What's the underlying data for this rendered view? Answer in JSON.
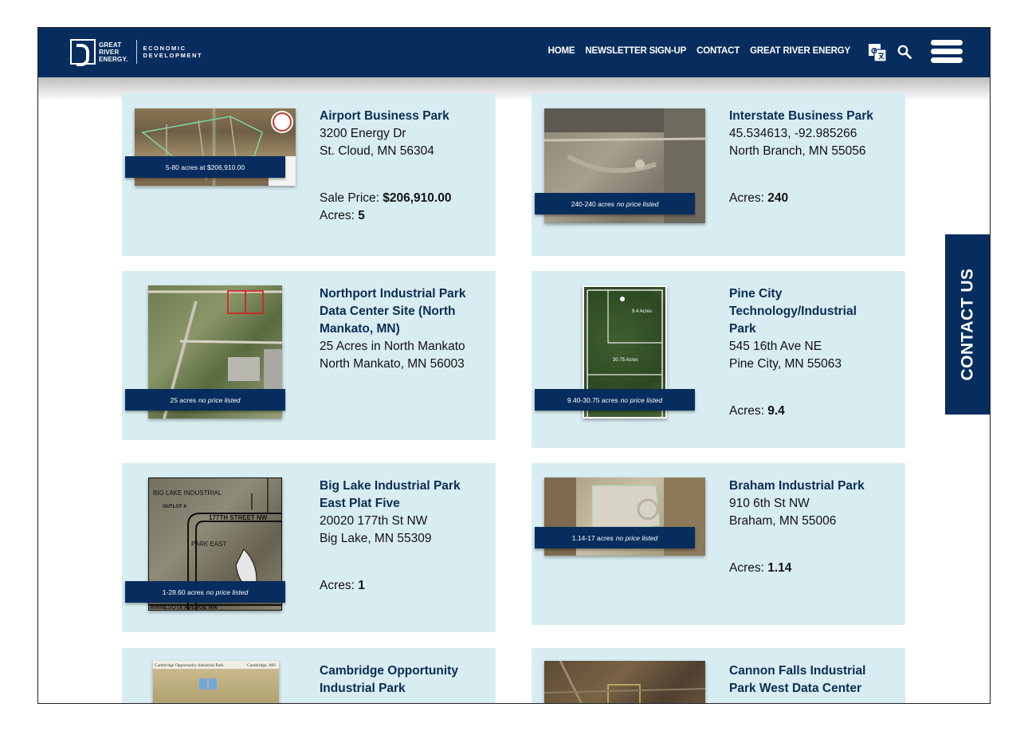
{
  "header": {
    "logo_line1": "GREAT",
    "logo_line2": "RIVER",
    "logo_line3": "ENERGY.",
    "logo_sub1": "ECONOMIC",
    "logo_sub2": "DEVELOPMENT",
    "nav": [
      "HOME",
      "NEWSLETTER SIGN-UP",
      "CONTACT",
      "GREAT RIVER ENERGY"
    ]
  },
  "contact_tab": "CONTACT US",
  "listings": [
    {
      "title": "Airport Business Park",
      "address1": "3200 Energy Dr",
      "address2": "St. Cloud, MN 56304",
      "sale_label": "Sale Price: ",
      "sale_value": "$206,910.00",
      "acres_label": "Acres: ",
      "acres_value": "5",
      "badge_text": "5-80 acres at $206,910.00",
      "badge_note": ""
    },
    {
      "title": "Interstate Business Park",
      "address1": "45.534613, -92.985266",
      "address2": "North Branch, MN 55056",
      "acres_label": "Acres: ",
      "acres_value": "240",
      "badge_text": "240-240 acres",
      "badge_note": "no price listed"
    },
    {
      "title_line1": "Northport Industrial Park",
      "title_line2": "Data Center Site (North",
      "title_line3": "Mankato, MN)",
      "address1": "25 Acres in North Mankato",
      "address2": "North Mankato, MN 56003",
      "badge_text": "25 acres",
      "badge_note": "no price listed"
    },
    {
      "title_line1": "Pine City",
      "title_line2": "Technology/Industrial",
      "title_line3": "Park",
      "address1": "545 16th Ave NE",
      "address2": "Pine City, MN 55063",
      "acres_label": "Acres: ",
      "acres_value": "9.4",
      "badge_text": "9.40-30.75 acres",
      "badge_note": "no price listed",
      "map_label1": "9.4 Acres",
      "map_label2": "30.75 Acres"
    },
    {
      "title_line1": "Big Lake Industrial Park",
      "title_line2": "East Plat Five",
      "address1": "20020 177th St NW",
      "address2": "Big Lake, MN 55309",
      "acres_label": "Acres: ",
      "acres_value": "1",
      "badge_text": "1-28.60 acres",
      "badge_note": "no price listed",
      "plat_label1": "BIG LAKE INDUSTRIAL",
      "plat_label2": "OUTLOT A",
      "plat_label3": "177TH STREET NW",
      "plat_label4": "PARK EAST",
      "plat_label5": "MINNESOTA AVENUE NW"
    },
    {
      "title": "Braham Industrial Park",
      "address1": "910 6th St NW",
      "address2": "Braham, MN 55006",
      "acres_label": "Acres: ",
      "acres_value": "1.14",
      "badge_text": "1.14-17 acres",
      "badge_note": "no price listed"
    },
    {
      "title_line1": "Cambridge Opportunity",
      "title_line2": "Industrial Park",
      "map_caption_left": "Cambridge Opportunity Industrial Park",
      "map_caption_right": "Cambridge, MN"
    },
    {
      "title_line1": "Cannon Falls Industrial",
      "title_line2": "Park West Data Center"
    }
  ],
  "colors": {
    "navy": "#062d5e",
    "card_bg": "#d8edf1",
    "title_blue": "#0b2b55"
  }
}
